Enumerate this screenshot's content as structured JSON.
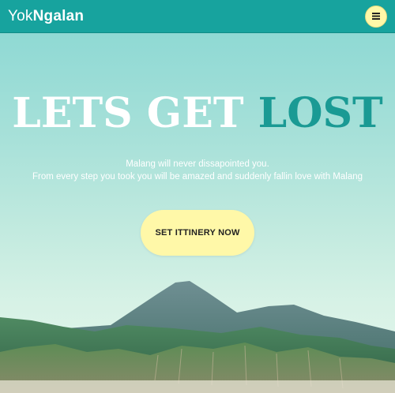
{
  "navbar": {
    "brand_light": "Yok",
    "brand_bold": "Ngalan",
    "menu_icon": "hamburger-icon",
    "colors": {
      "bar": "#17a39e",
      "menu_button": "#fff8a8"
    }
  },
  "hero": {
    "headline_white": "LETS GET ",
    "headline_teal": "LOST",
    "tagline_line1": "Malang will never dissapointed you.",
    "tagline_line2": "From every step you took you will be amazed and suddenly fallin love with Malang",
    "cta_label": "SET ITTINERY NOW",
    "colors": {
      "accent": "#1a9a94",
      "cta": "#fff8a8"
    }
  }
}
